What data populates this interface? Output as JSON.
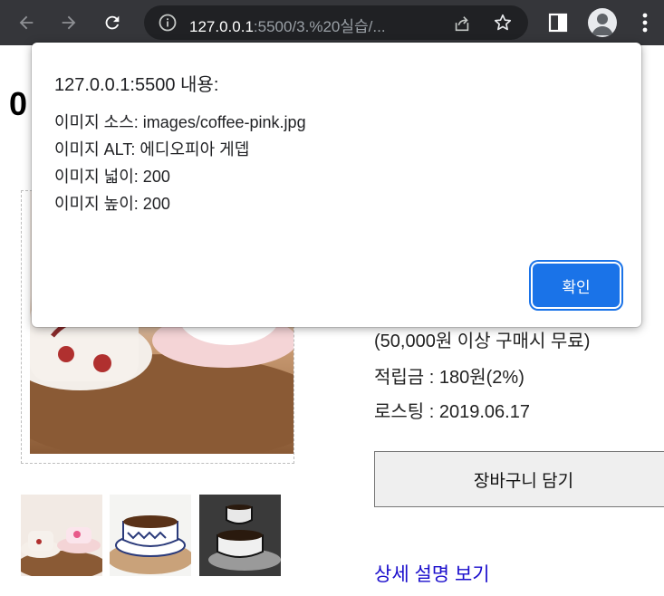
{
  "browser": {
    "url_host": "127.0.0.1",
    "url_rest": ":5500/3.%20실습/..."
  },
  "page": {
    "title_fragment": "0",
    "shipping_note": "(50,000원 이상 구매시 무료)",
    "points": "적립금 : 180원(2%)",
    "roasting": "로스팅 : 2019.06.17",
    "cart_button": "장바구니 담기",
    "detail_link": "상세 설명 보기"
  },
  "dialog": {
    "title": "127.0.0.1:5500 내용:",
    "lines": [
      "이미지 소스: images/coffee-pink.jpg",
      "이미지 ALT: 에디오피아 게뎁",
      "이미지 넓이: 200",
      "이미지 높이: 200"
    ],
    "ok_label": "확인"
  },
  "colors": {
    "chrome_bg": "#35363a",
    "omnibox_bg": "#202124",
    "accent_blue": "#1a73e8",
    "link_blue": "#1a0dcc"
  }
}
